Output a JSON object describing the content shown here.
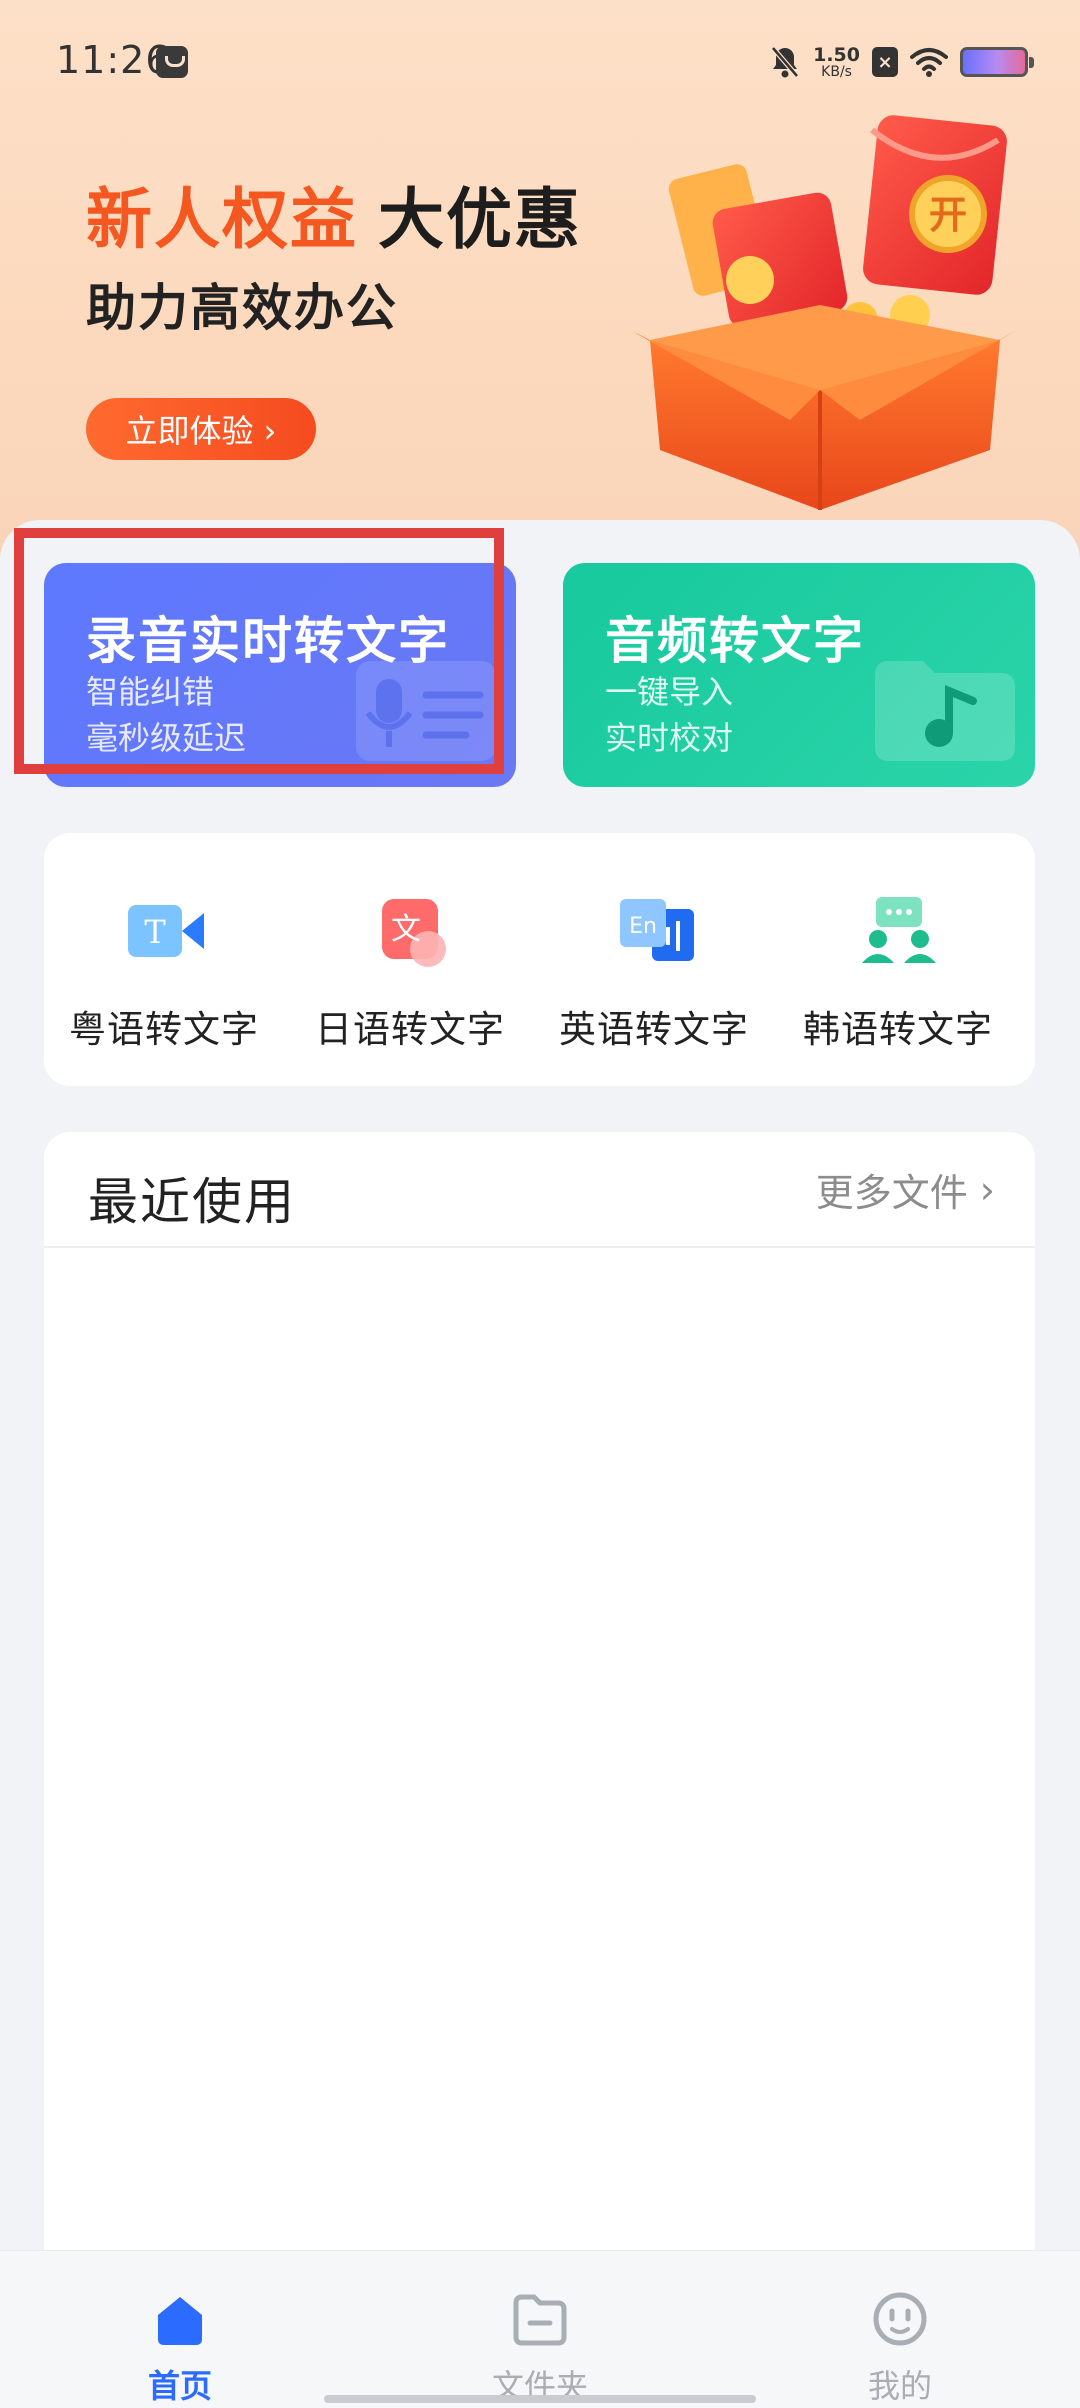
{
  "status_bar": {
    "time": "11:26",
    "net_speed_value": "1.50",
    "net_speed_unit": "KB/s",
    "x_badge": "×"
  },
  "banner": {
    "title_highlight": "新人权益",
    "title_rest": "大优惠",
    "subtitle": "助力高效办公",
    "button_label": "立即体验 ›",
    "gift_label": "开"
  },
  "cards": {
    "record": {
      "title": "录音实时转文字",
      "line1": "智能纠错",
      "line2": "毫秒级延迟"
    },
    "audio": {
      "title": "音频转文字",
      "line1": "一键导入",
      "line2": "实时校对"
    }
  },
  "languages": [
    {
      "label": "粤语转文字",
      "icon": "cantonese-video-icon",
      "glyph": "T"
    },
    {
      "label": "日语转文字",
      "icon": "japanese-translate-icon",
      "glyph": "文"
    },
    {
      "label": "英语转文字",
      "icon": "english-translate-icon",
      "glyph": "En"
    },
    {
      "label": "韩语转文字",
      "icon": "korean-chat-icon",
      "glyph": ""
    }
  ],
  "recent": {
    "title": "最近使用",
    "more_label": "更多文件",
    "more_chevron": "›"
  },
  "bottom_nav": {
    "items": [
      {
        "label": "首页",
        "icon": "home-icon",
        "active": true
      },
      {
        "label": "文件夹",
        "icon": "folder-icon",
        "active": false
      },
      {
        "label": "我的",
        "icon": "profile-face-icon",
        "active": false
      }
    ]
  },
  "colors": {
    "accent_orange": "#f4571f",
    "record_card": "#5d78ff",
    "audio_card": "#17c99d",
    "nav_active": "#2b6bff",
    "highlight_box": "#e0403d"
  }
}
